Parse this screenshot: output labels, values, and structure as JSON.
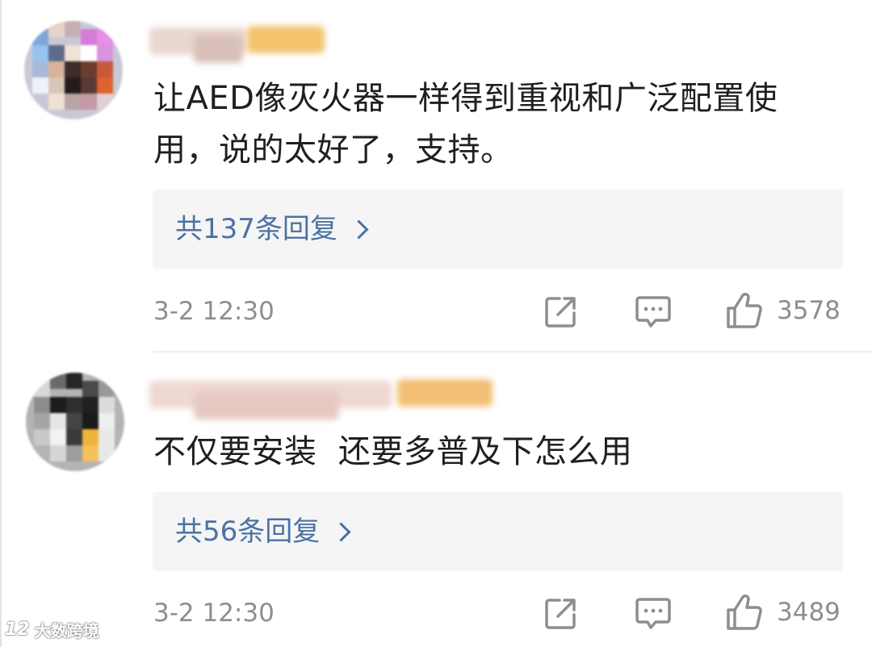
{
  "comments": [
    {
      "text_line1": "让AED像灭火器一样得到重视和广泛配置使",
      "text_line2": "用，说的太好了，支持。",
      "replies_label": "共137条回复",
      "time": "3-2 12:30",
      "likes": "3578"
    },
    {
      "text_line1": "不仅要安装  还要多普及下怎么用",
      "replies_label": "共56条回复",
      "time": "3-2 12:30",
      "likes": "3489"
    }
  ],
  "watermark": {
    "text": "大数跨境",
    "logo_text": "12"
  },
  "colors": {
    "link": "#4b72a4",
    "meta": "#8e8e8e",
    "reply_bg": "#f5f5f5"
  },
  "icons": [
    "share-icon",
    "comment-icon",
    "thumbs-up-icon",
    "chevron-right-icon"
  ]
}
